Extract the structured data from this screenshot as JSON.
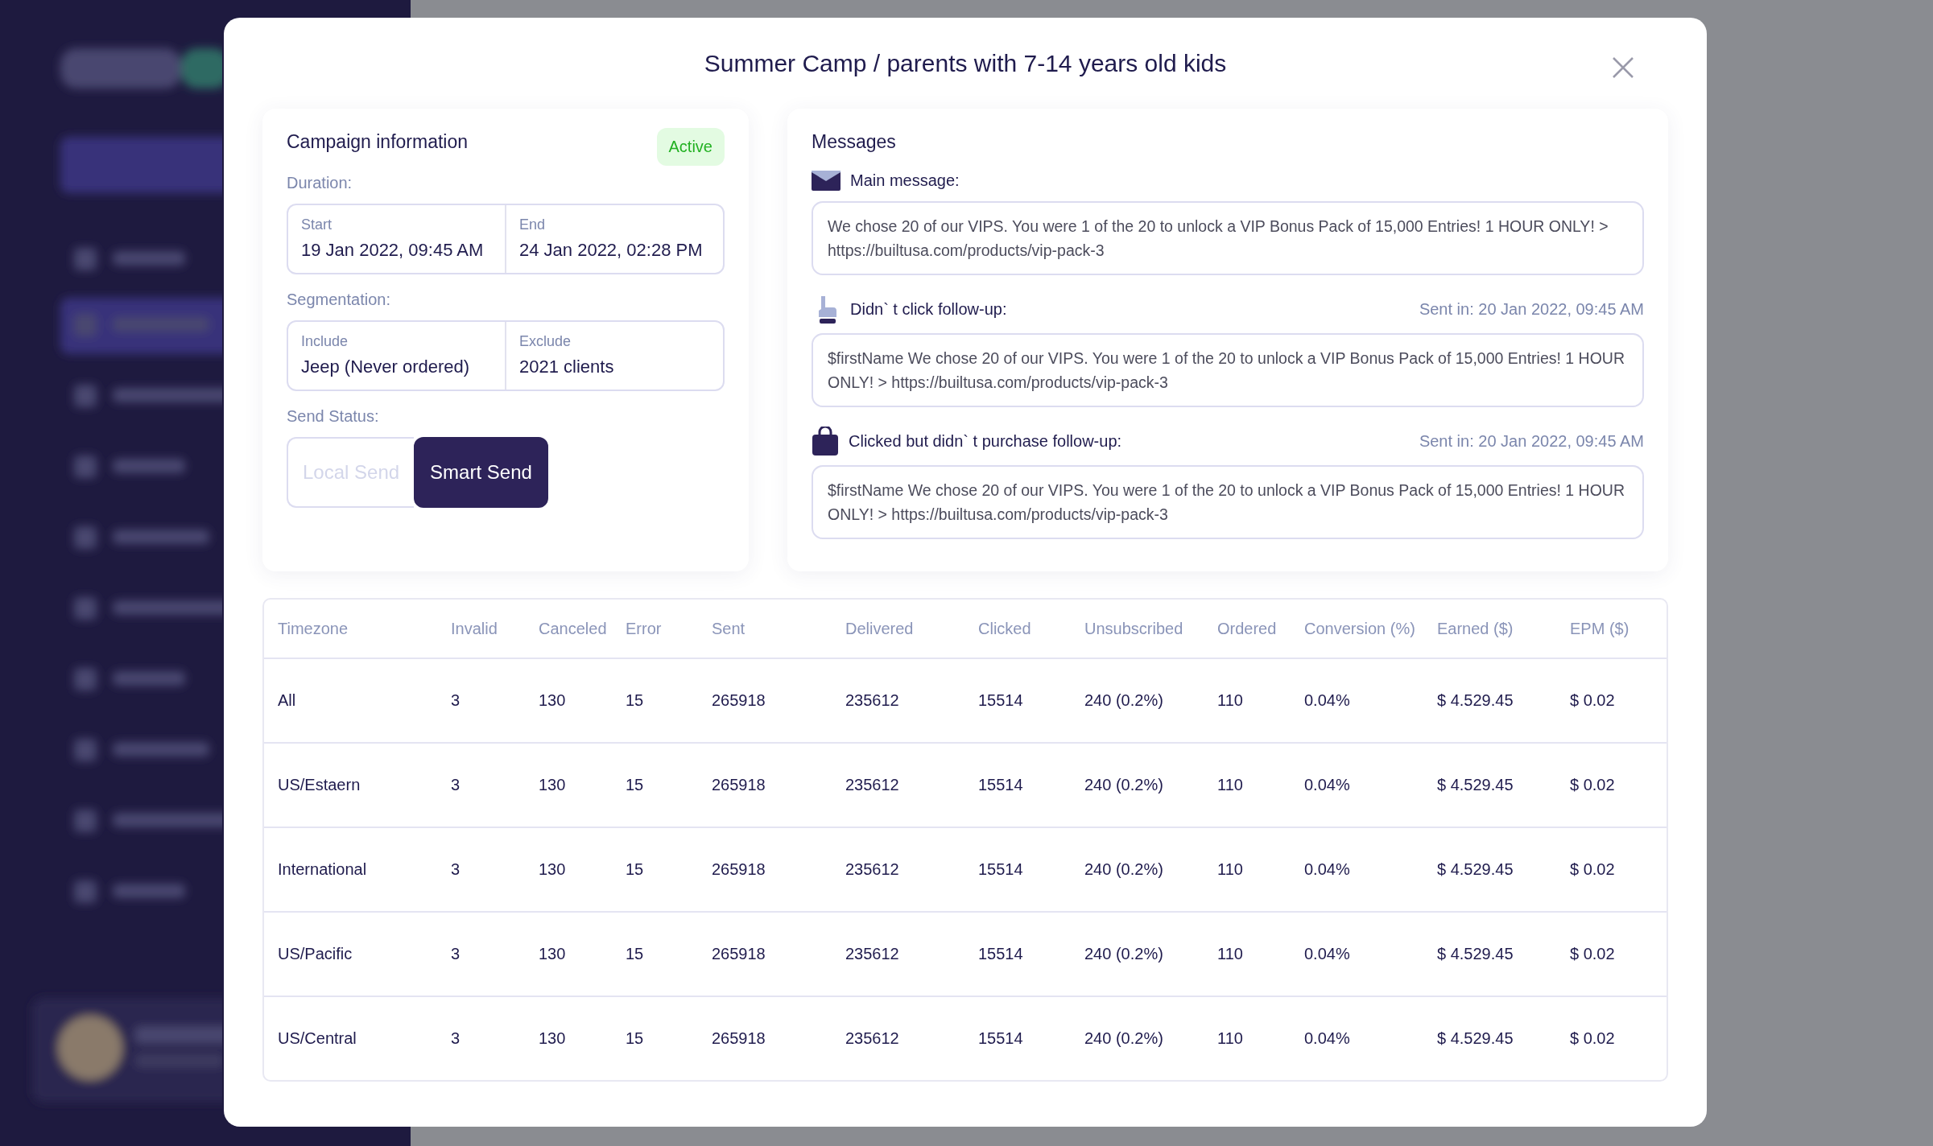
{
  "modal": {
    "title": "Summer Camp / parents with 7-14 years old kids"
  },
  "campaign": {
    "heading": "Campaign information",
    "status": {
      "label": "Active",
      "kind": "active"
    },
    "duration": {
      "label": "Duration:",
      "fields": [
        {
          "label": "Start",
          "value": "19 Jan 2022, 09:45 AM"
        },
        {
          "label": "End",
          "value": "24 Jan 2022, 02:28 PM"
        }
      ]
    },
    "segmentation": {
      "label": "Segmentation:",
      "fields": [
        {
          "label": "Include",
          "value": "Jeep (Never ordered)"
        },
        {
          "label": "Exclude",
          "value": "2021 clients"
        }
      ]
    },
    "send_status": {
      "label": "Send Status:",
      "options": [
        {
          "label": "Local Send",
          "selected": false
        },
        {
          "label": "Smart Send",
          "selected": true
        }
      ]
    }
  },
  "messages": {
    "heading": "Messages",
    "items": [
      {
        "kind": "mail",
        "label": "Main message:",
        "text": "We chose 20 of our VIPS. You were 1 of the 20 to unlock a VIP Bonus Pack of 15,000 Entries! 1 HOUR ONLY! > https://builtusa.com/products/vip-pack-3"
      },
      {
        "kind": "pointer",
        "label": "Didn` t click follow-up:",
        "sent": "Sent in: 20 Jan 2022, 09:45 AM",
        "text": "$firstName We chose 20 of our VIPS. You were 1 of the 20 to unlock a VIP Bonus Pack of 15,000 Entries! 1 HOUR ONLY! > https://builtusa.com/products/vip-pack-3"
      },
      {
        "kind": "bag",
        "label": "Clicked but didn` t purchase follow-up:",
        "sent": "Sent in: 20 Jan 2022, 09:45 AM",
        "text": "$firstName We chose 20 of our VIPS. You were 1 of the 20 to unlock a VIP Bonus Pack of 15,000 Entries! 1 HOUR ONLY! > https://builtusa.com/products/vip-pack-3"
      }
    ]
  },
  "table": {
    "columns": [
      "Timezone",
      "Invalid",
      "Canceled",
      "Error",
      "Sent",
      "Delivered",
      "Clicked",
      "Unsubscribed",
      "Ordered",
      "Conversion (%)",
      "Earned ($)",
      "EPM ($)"
    ],
    "rows": [
      [
        "All",
        "3",
        "130",
        "15",
        "265918",
        "235612",
        "15514",
        "240 (0.2%)",
        "110",
        "0.04%",
        "$ 4.529.45",
        "$ 0.02"
      ],
      [
        "US/Estaern",
        "3",
        "130",
        "15",
        "265918",
        "235612",
        "15514",
        "240 (0.2%)",
        "110",
        "0.04%",
        "$ 4.529.45",
        "$ 0.02"
      ],
      [
        "International",
        "3",
        "130",
        "15",
        "265918",
        "235612",
        "15514",
        "240 (0.2%)",
        "110",
        "0.04%",
        "$ 4.529.45",
        "$ 0.02"
      ],
      [
        "US/Pacific",
        "3",
        "130",
        "15",
        "265918",
        "235612",
        "15514",
        "240 (0.2%)",
        "110",
        "0.04%",
        "$ 4.529.45",
        "$ 0.02"
      ],
      [
        "US/Central",
        "3",
        "130",
        "15",
        "265918",
        "235612",
        "15514",
        "240 (0.2%)",
        "110",
        "0.04%",
        "$ 4.529.45",
        "$ 0.02"
      ]
    ]
  }
}
